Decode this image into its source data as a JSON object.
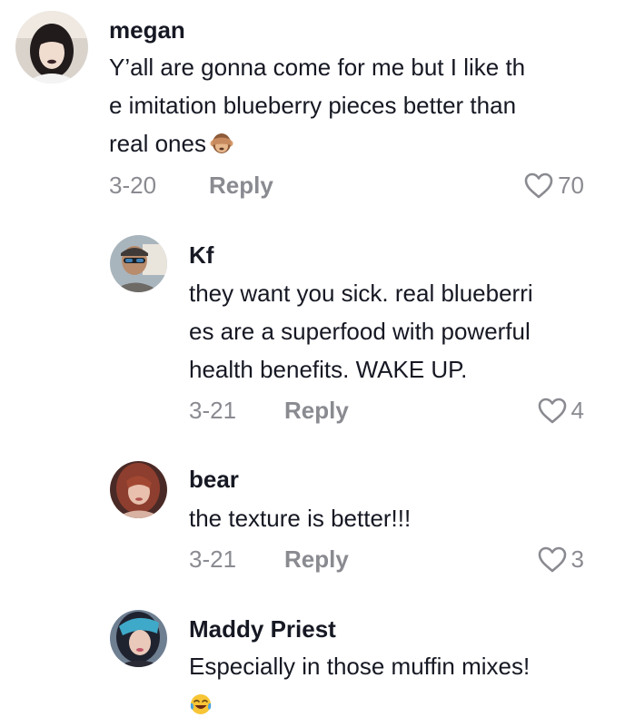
{
  "comments": [
    {
      "username": "megan",
      "text_lines": [
        "Y’all are gonna come for me but I like th",
        "e imitation blueberry pieces better than",
        "real ones"
      ],
      "emoji": "see-no-evil-monkey",
      "date": "3-20",
      "reply_label": "Reply",
      "likes": "70"
    },
    {
      "username": "Kf",
      "text_lines": [
        "they want you sick. real blueberri",
        "es are a superfood with powerful",
        "health benefits. WAKE UP."
      ],
      "date": "3-21",
      "reply_label": "Reply",
      "likes": "4"
    },
    {
      "username": "bear",
      "text_lines": [
        "the texture is better!!!"
      ],
      "date": "3-21",
      "reply_label": "Reply",
      "likes": "3"
    },
    {
      "username": "Maddy Priest",
      "text_lines": [
        "Especially in those muffin mixes!"
      ],
      "emoji": "face-with-tears-of-joy"
    }
  ],
  "colors": {
    "text_primary": "#161823",
    "text_secondary": "#8a8b91",
    "background": "#ffffff"
  }
}
